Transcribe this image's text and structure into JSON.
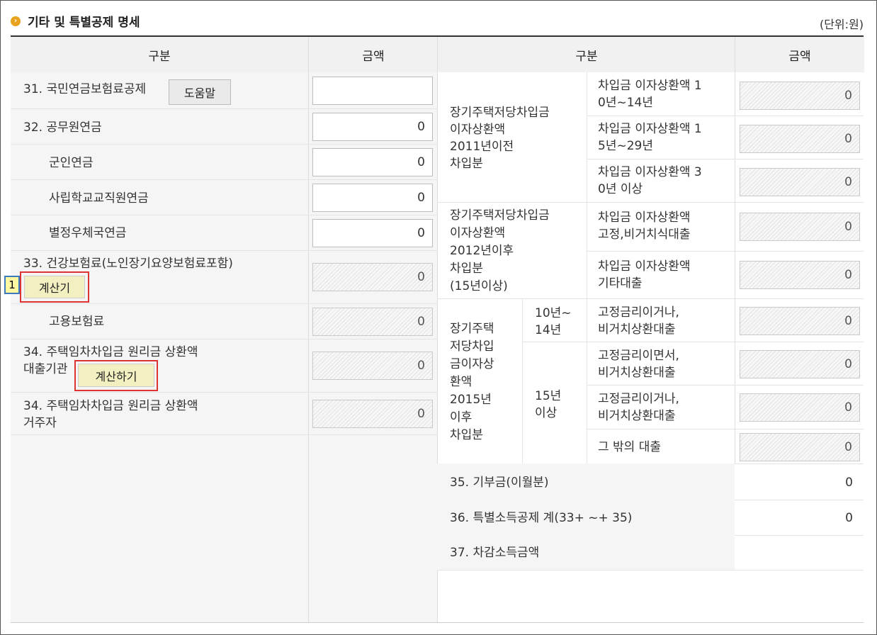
{
  "title": "기타 및 특별공제 명세",
  "unit": "(단위:원)",
  "headers": {
    "left_category": "구분",
    "left_amount": "금액",
    "right_category": "구분",
    "right_amount": "금액"
  },
  "left": {
    "r31_label": "31. 국민연금보험료공제",
    "r31_help": "도움말",
    "r31_value": "",
    "r32_label": "32. 공무원연금",
    "r32_value": "0",
    "military_label": "군인연금",
    "military_value": "0",
    "teacher_label": "사립학교교직원연금",
    "teacher_value": "0",
    "postal_label": "별정우체국연금",
    "postal_value": "0",
    "r33_label": "33. 건강보험료(노인장기요양보험료포함)",
    "r33_calc": "계산기",
    "r33_value": "0",
    "employment_label": "고용보험료",
    "employment_value": "0",
    "r34a_label_1": "34. 주택임차차입금 원리금 상환액",
    "r34a_label_2": "대출기관",
    "r34a_calc": "계산하기",
    "r34a_value": "0",
    "r34b_label_1": "34. 주택임차차입금 원리금 상환액",
    "r34b_label_2": "거주자",
    "r34b_value": "0"
  },
  "marker": "1",
  "right": {
    "g1_lines": [
      "장기주택저당차입금",
      "이자상환액",
      "2011년이전",
      "차입분"
    ],
    "g1_items": [
      {
        "line1": "차입금 이자상환액 1",
        "line2": "0년~14년",
        "value": "0"
      },
      {
        "line1": "차입금 이자상환액 1",
        "line2": "5년~29년",
        "value": "0"
      },
      {
        "line1": "차입금 이자상환액 3",
        "line2": "0년 이상",
        "value": "0"
      }
    ],
    "g2_lines": [
      "장기주택저당차입금",
      "이자상환액",
      "2012년이후",
      "차입분",
      "(15년이상)"
    ],
    "g2_items": [
      {
        "line1": "차입금 이자상환액",
        "line2": "고정,비거치식대출",
        "value": "0"
      },
      {
        "line1": "차입금 이자상환액",
        "line2": "기타대출",
        "value": "0"
      }
    ],
    "g3_lines": [
      "장기주택",
      "저당차입",
      "금이자상",
      "환액",
      "2015년",
      "이후",
      "차입분"
    ],
    "g3_sub1_lines": [
      "10년~",
      "14년"
    ],
    "g3_sub2_lines": [
      "15년",
      "이상"
    ],
    "g3_items": [
      {
        "line1": "고정금리이거나,",
        "line2": "비거치상환대출",
        "value": "0"
      },
      {
        "line1": "고정금리이면서,",
        "line2": "비거치상환대출",
        "value": "0"
      },
      {
        "line1": "고정금리이거나,",
        "line2": "비거치상환대출",
        "value": "0"
      },
      {
        "line1": "그 밖의 대출",
        "line2": "",
        "value": "0"
      }
    ],
    "r35_label": "35. 기부금(이월분)",
    "r35_value": "0",
    "r36_label": "36. 특별소득공제 계(33+ ~+ 35)",
    "r36_value": "0",
    "r37_label": "37. 차감소득금액",
    "r37_value": ""
  }
}
